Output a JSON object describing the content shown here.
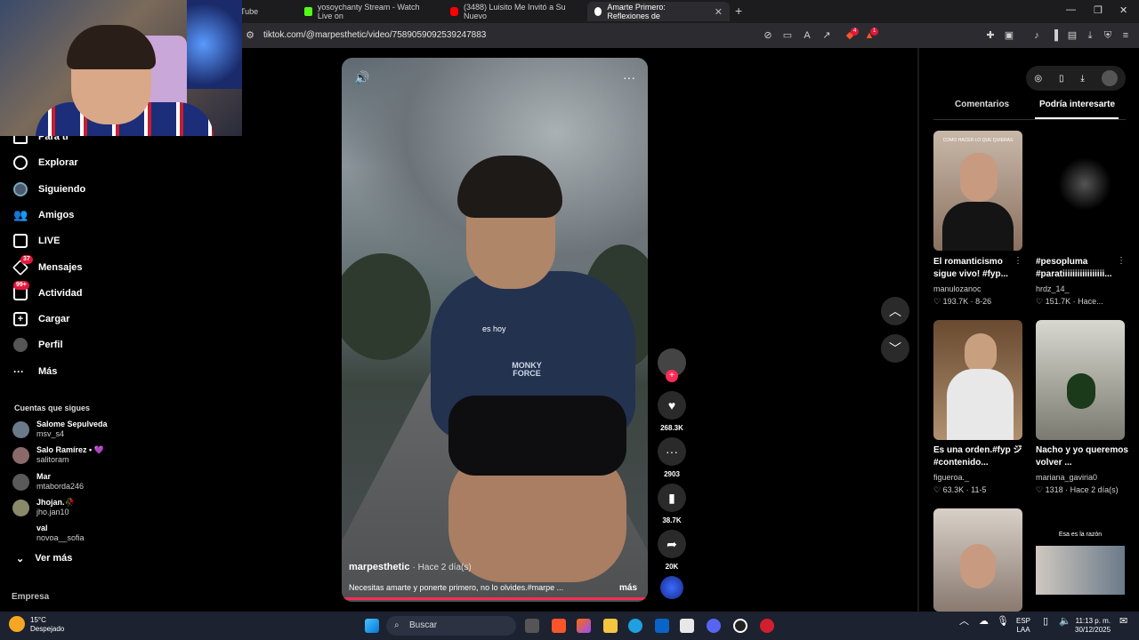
{
  "browser": {
    "tabs": [
      {
        "label": "Tube",
        "color": "#ff0000"
      },
      {
        "label": "yosoychanty Stream - Watch Live on",
        "color": "#53fc18"
      },
      {
        "label": "(3488) Luisito Me Invitó a Su Nuevo",
        "color": "#ff0000"
      },
      {
        "label": "Amarte Primero: Reflexiones de",
        "color": "#ffffff"
      }
    ],
    "url": "tiktok.com/@marpesthetic/video/7589059092539247883",
    "ext_badge_1": "4",
    "ext_badge_2": "1"
  },
  "sidebar": {
    "items": [
      {
        "label": "Para ti",
        "icon": "home-icon"
      },
      {
        "label": "Explorar",
        "icon": "compass-icon"
      },
      {
        "label": "Siguiendo",
        "icon": "following-avatar-icon"
      },
      {
        "label": "Amigos",
        "icon": "friends-icon"
      },
      {
        "label": "LIVE",
        "icon": "live-tv-icon"
      },
      {
        "label": "Mensajes",
        "icon": "messages-icon",
        "badge": "37"
      },
      {
        "label": "Actividad",
        "icon": "activity-icon",
        "badge": "99+"
      },
      {
        "label": "Cargar",
        "icon": "upload-icon"
      },
      {
        "label": "Perfil",
        "icon": "profile-icon"
      },
      {
        "label": "Más",
        "icon": "more-icon"
      }
    ],
    "following_title": "Cuentas que sigues",
    "following": [
      {
        "name": "Salome Sepulveda",
        "handle": "msv_s4"
      },
      {
        "name": "Salo Ramírez • 💜",
        "handle": "salitoram"
      },
      {
        "name": "Mar",
        "handle": "mtaborda246"
      },
      {
        "name": "Jhojan.🥀",
        "handle": "jho.jan10"
      },
      {
        "name": "val",
        "handle": "novoa__sofia"
      }
    ],
    "see_more": "Ver más",
    "company": "Empresa"
  },
  "video": {
    "caption_overlay": "es hoy",
    "shirt_text": "MONKY FORCE",
    "author": "marpesthetic",
    "time_ago": "· Hace 2 día(s)",
    "description": "Necesitas amarte y ponerte primero, no lo olvides.#marpe ...",
    "more": "más",
    "likes": "268.3K",
    "comments": "2903",
    "saves": "38.7K",
    "shares": "20K"
  },
  "right_panel": {
    "tabs": [
      "Comentarios",
      "Podría interesarte"
    ],
    "active_tab": "Podría interesarte",
    "cards": [
      {
        "thumb_text": "COMO HACER LO QUE QUIERAS",
        "title": "El romanticismo sigue vivo! #fyp...",
        "author": "manulozanoc",
        "likes": "193.7K",
        "date": "8-26"
      },
      {
        "thumb_text": "",
        "title": "#pesopluma #paratiiiiiiiiiiiiiiiii...",
        "author": "hrdz_14_",
        "likes": "151.7K",
        "date": "Hace..."
      },
      {
        "thumb_text": "",
        "title": "Es una orden.#fyp ジ #contenido...",
        "author": "figueroa._",
        "likes": "63.3K",
        "date": "11-5"
      },
      {
        "thumb_text": "",
        "title": "Nacho y yo queremos volver ...",
        "author": "mariana_gaviria0",
        "likes": "1318",
        "date": "Hace 2 día(s)"
      },
      {
        "thumb_text": "",
        "title": "",
        "author": "",
        "likes": "",
        "date": ""
      },
      {
        "thumb_text": "Esa es la razón",
        "title": "",
        "author": "",
        "likes": "",
        "date": ""
      }
    ]
  },
  "taskbar": {
    "weather_temp": "15°C",
    "weather_desc": "Despejado",
    "search_placeholder": "Buscar",
    "lang": "ESP",
    "lang2": "LAA",
    "time": "11:13 p. m.",
    "date": "30/12/2025"
  },
  "colors": {
    "accent": "#fe2c55",
    "bg": "#000000"
  }
}
